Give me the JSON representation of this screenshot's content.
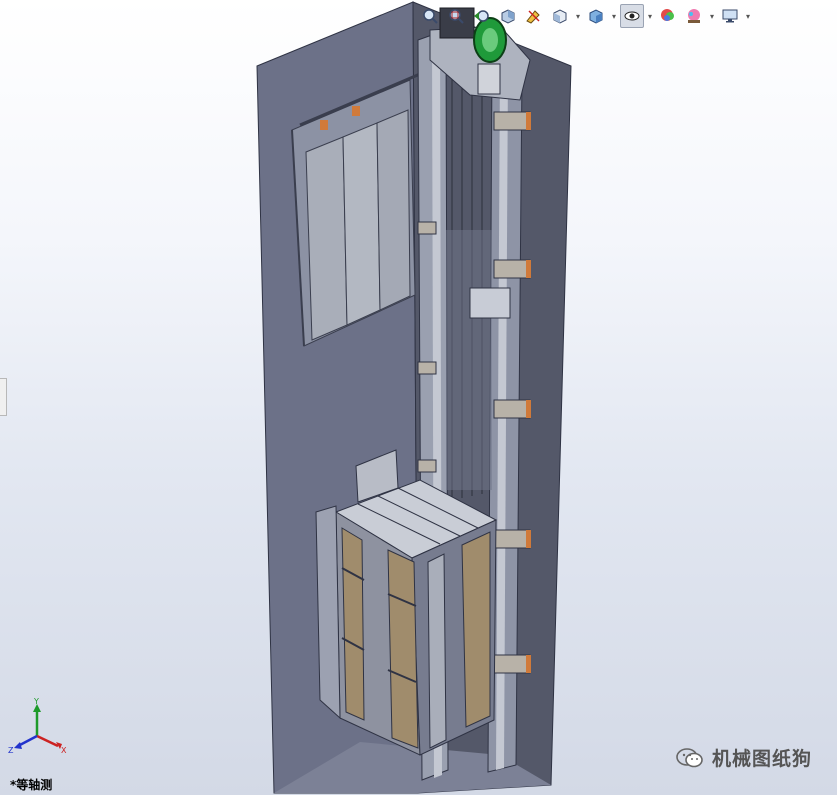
{
  "viewport": {
    "view_orientation": "*等轴测",
    "background_top": "#ffffff",
    "background_bottom": "#d3d9e6"
  },
  "toolbar": {
    "items": [
      {
        "icon": "zoom-to-fit-icon"
      },
      {
        "icon": "zoom-to-area-icon"
      },
      {
        "icon": "previous-view-icon"
      },
      {
        "icon": "section-view-icon"
      },
      {
        "icon": "dynamic-annotation-icon"
      },
      {
        "icon": "view-orientation-icon"
      },
      {
        "icon": "display-style-icon"
      },
      {
        "icon": "hide-show-items-icon"
      },
      {
        "icon": "edit-appearance-icon"
      },
      {
        "icon": "apply-scene-icon"
      },
      {
        "icon": "view-settings-icon"
      }
    ]
  },
  "triad": {
    "x_label": "X",
    "y_label": "Y",
    "z_label": "Z"
  },
  "watermark": {
    "text": "机械图纸狗",
    "icon": "wechat-icon"
  },
  "model": {
    "name": "elevator-shaft-assembly",
    "wall_color": "#585c72",
    "car_panel_color": "#a08c6c"
  }
}
